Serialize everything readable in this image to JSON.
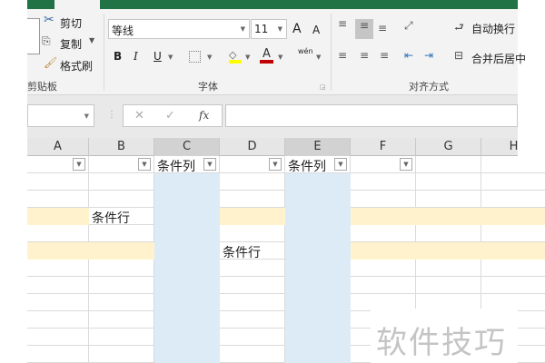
{
  "ribbon": {
    "clipboard": {
      "cut": "剪切",
      "copy": "复制",
      "format_painter": "格式刷",
      "group": "剪贴板"
    },
    "font": {
      "name": "等线",
      "size": "11",
      "bold": "B",
      "italic": "I",
      "underline": "U",
      "grow": "A",
      "shrink": "A",
      "phonetic": "wén",
      "group": "字体"
    },
    "alignment": {
      "wrap": "自动换行",
      "merge": "合并后居中",
      "group": "对齐方式"
    }
  },
  "formula_bar": {
    "fx": "fx",
    "cancel": "✕",
    "enter": "✓"
  },
  "columns": [
    "A",
    "B",
    "C",
    "D",
    "E",
    "F",
    "G",
    "H"
  ],
  "header_row": {
    "C": "条件列",
    "E": "条件列"
  },
  "condition_rows": [
    {
      "col": "B",
      "text": "条件行"
    },
    {
      "col": "D",
      "text": "条件行"
    }
  ],
  "colors": {
    "green": "#217346",
    "row_highlight": "#fff2cc",
    "col_highlight": "#ddebf7"
  },
  "watermark": "软件技巧"
}
